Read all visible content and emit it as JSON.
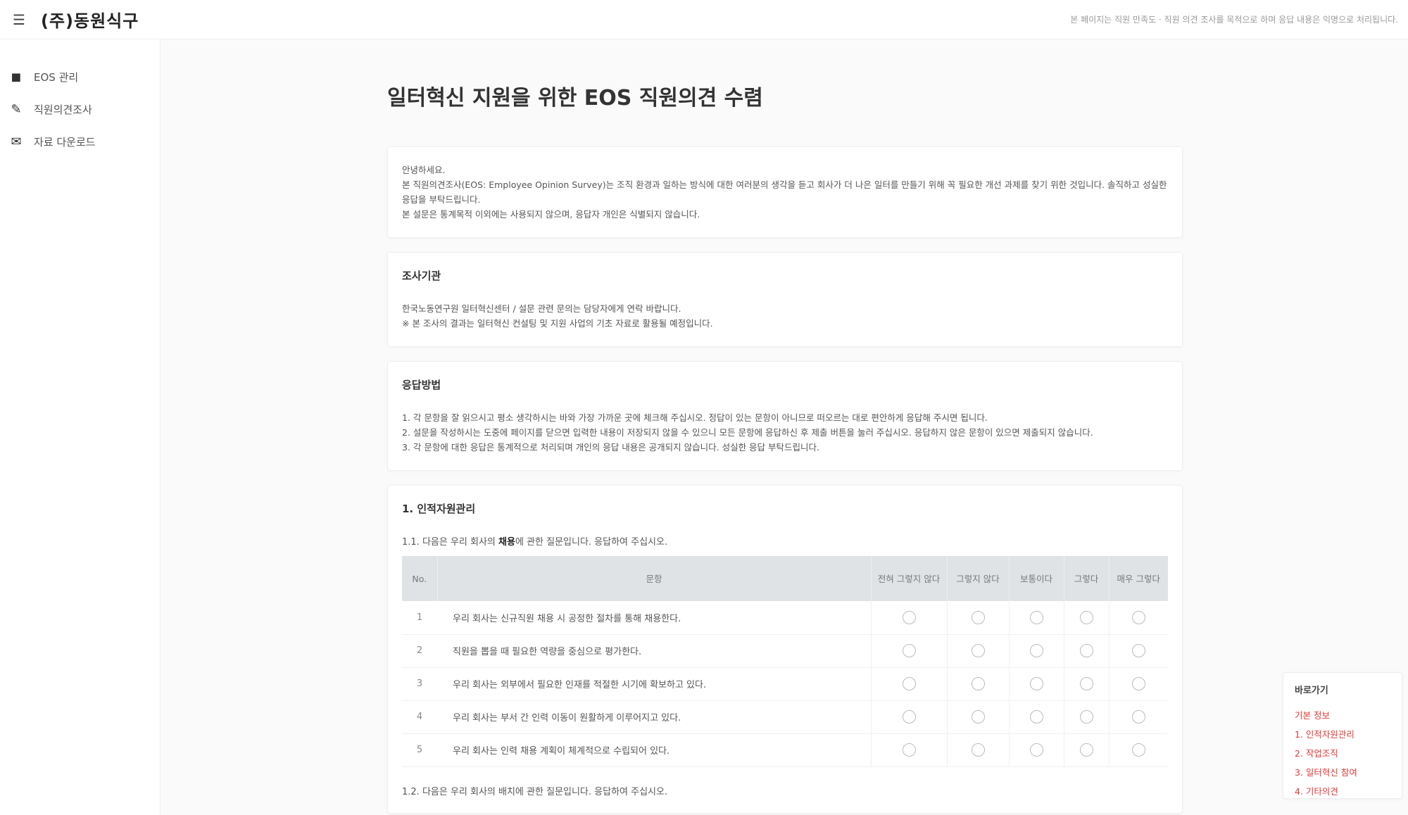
{
  "header": {
    "menu_icon": "hamburger-icon",
    "brand": "(주)동원식구",
    "notice": "본 페이지는 직원 만족도 · 직원 의견 조사를 목적으로 하며 응답 내용은 익명으로 처리됩니다."
  },
  "sidebar": {
    "items": [
      {
        "icon": "dashboard-icon",
        "label": "EOS 관리"
      },
      {
        "icon": "edit-icon",
        "label": "직원의견조사"
      },
      {
        "icon": "chat-icon",
        "label": "자료 다운로드"
      }
    ]
  },
  "main": {
    "title": "일터혁신 지원을 위한 EOS 직원의견 수렴",
    "intro": {
      "greeting": "안녕하세요.",
      "line1": "본 직원의견조사(EOS: Employee Opinion Survey)는 조직 환경과 일하는 방식에 대한 여러분의 생각을 듣고 회사가 더 나은 일터를 만들기 위해 꼭 필요한 개선 과제를 찾기 위한 것입니다. 솔직하고 성실한 응답을 부탁드립니다.",
      "line2": "본 설문은 통계목적 이외에는 사용되지 않으며, 응답자 개인은 식별되지 않습니다."
    },
    "org_section": {
      "title": "조사기관",
      "line1": "한국노동연구원 일터혁신센터 / 설문 관련 문의는 담당자에게 연락 바랍니다.",
      "line2": "※ 본 조사의 결과는 일터혁신 컨설팅 및 지원 사업의 기초 자료로 활용될 예정입니다."
    },
    "method_section": {
      "title": "응답방법",
      "line1": "1. 각 문항을 잘 읽으시고 평소 생각하시는 바와 가장 가까운 곳에 체크해 주십시오. 정답이 있는 문항이 아니므로 떠오르는 대로 편안하게 응답해 주시면 됩니다.",
      "line2": "2. 설문을 작성하시는 도중에 페이지를 닫으면 입력한 내용이 저장되지 않을 수 있으니 모든 문항에 응답하신 후 제출 버튼을 눌러 주십시오. 응답하지 않은 문항이 있으면 제출되지 않습니다.",
      "line3": "3. 각 문항에 대한 응답은 통계적으로 처리되며 개인의 응답 내용은 공개되지 않습니다. 성실한 응답 부탁드립니다."
    },
    "section1": {
      "title": "1. 인적자원관리",
      "prompt_prefix": "1.1. 다음은 우리 회사의 ",
      "prompt_bold": "채용",
      "prompt_suffix": "에 관한 질문입니다. 응답하여 주십시오.",
      "table": {
        "headers": {
          "no": "No.",
          "item": "문항",
          "opt1": "전혀 그렇지 않다",
          "opt2": "그렇지 않다",
          "opt3": "보통이다",
          "opt4": "그렇다",
          "opt5": "매우 그렇다"
        },
        "rows": [
          {
            "no": "1",
            "text": "우리 회사는 신규직원 채용 시 공정한 절차를 통해 채용한다."
          },
          {
            "no": "2",
            "text": "직원을 뽑을 때 필요한 역량을 중심으로 평가한다."
          },
          {
            "no": "3",
            "text": "우리 회사는 외부에서 필요한 인재를 적절한 시기에 확보하고 있다."
          },
          {
            "no": "4",
            "text": "우리 회사는 부서 간 인력 이동이 원활하게 이루어지고 있다."
          },
          {
            "no": "5",
            "text": "우리 회사는 인력 채용 계획이 체계적으로 수립되어 있다."
          }
        ]
      },
      "next_prompt": "1.2. 다음은 우리 회사의 배치에 관한 질문입니다. 응답하여 주십시오."
    }
  },
  "toc": {
    "title": "바로가기",
    "links": [
      "기본 정보",
      "1. 인적자원관리",
      "2. 작업조직",
      "3. 일터혁신 참여",
      "4. 기타의견"
    ]
  },
  "colors": {
    "accent": "#e53935",
    "table_header_bg": "#dfe3e6"
  }
}
